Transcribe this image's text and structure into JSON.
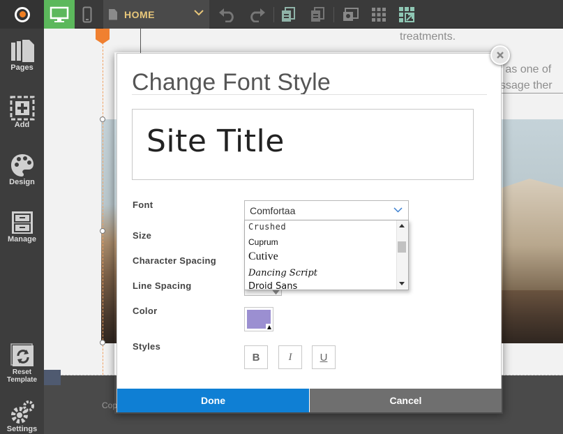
{
  "toolbar": {
    "page_name": "HOME",
    "icons": [
      "logo-icon",
      "desktop-icon",
      "mobile-icon",
      "page-icon",
      "chevron-down-icon",
      "undo-icon",
      "redo-icon",
      "copy-pages-icon",
      "paste-icon",
      "preview-icon",
      "grid-icon",
      "publish-icon"
    ]
  },
  "sidebar": {
    "items": [
      {
        "label": "Pages",
        "icon": "pages-icon"
      },
      {
        "label": "Add",
        "icon": "add-icon"
      },
      {
        "label": "Design",
        "icon": "palette-icon"
      },
      {
        "label": "Manage",
        "icon": "cabinet-icon"
      },
      {
        "label_line1": "Reset",
        "label_line2": "Template",
        "icon": "reset-icon"
      },
      {
        "label": "Settings",
        "icon": "gears-icon"
      }
    ]
  },
  "background_page": {
    "text_top": "treatments.",
    "text_right_1": "by as one of",
    "text_right_2": "essage ther",
    "footer_text": "Cop"
  },
  "modal": {
    "title": "Change Font Style",
    "preview_text": "Site Title",
    "labels": {
      "font": "Font",
      "size": "Size",
      "character_spacing": "Character Spacing",
      "line_spacing": "Line Spacing",
      "color": "Color",
      "styles": "Styles"
    },
    "font_select": {
      "value": "Comfortaa",
      "options_visible": [
        "Crushed",
        "Cuprum",
        "Cutive",
        "Dancing Script",
        "Droid Sans"
      ]
    },
    "color_value": "#9b8fd1",
    "style_buttons": {
      "bold": "B",
      "italic": "I",
      "underline": "U"
    },
    "done_label": "Done",
    "cancel_label": "Cancel"
  },
  "colors": {
    "accent_green": "#5cb85c",
    "done_blue": "#0f7fd4",
    "cancel_gray": "#6f6f6f",
    "page_name_gold": "#e8c77a"
  }
}
